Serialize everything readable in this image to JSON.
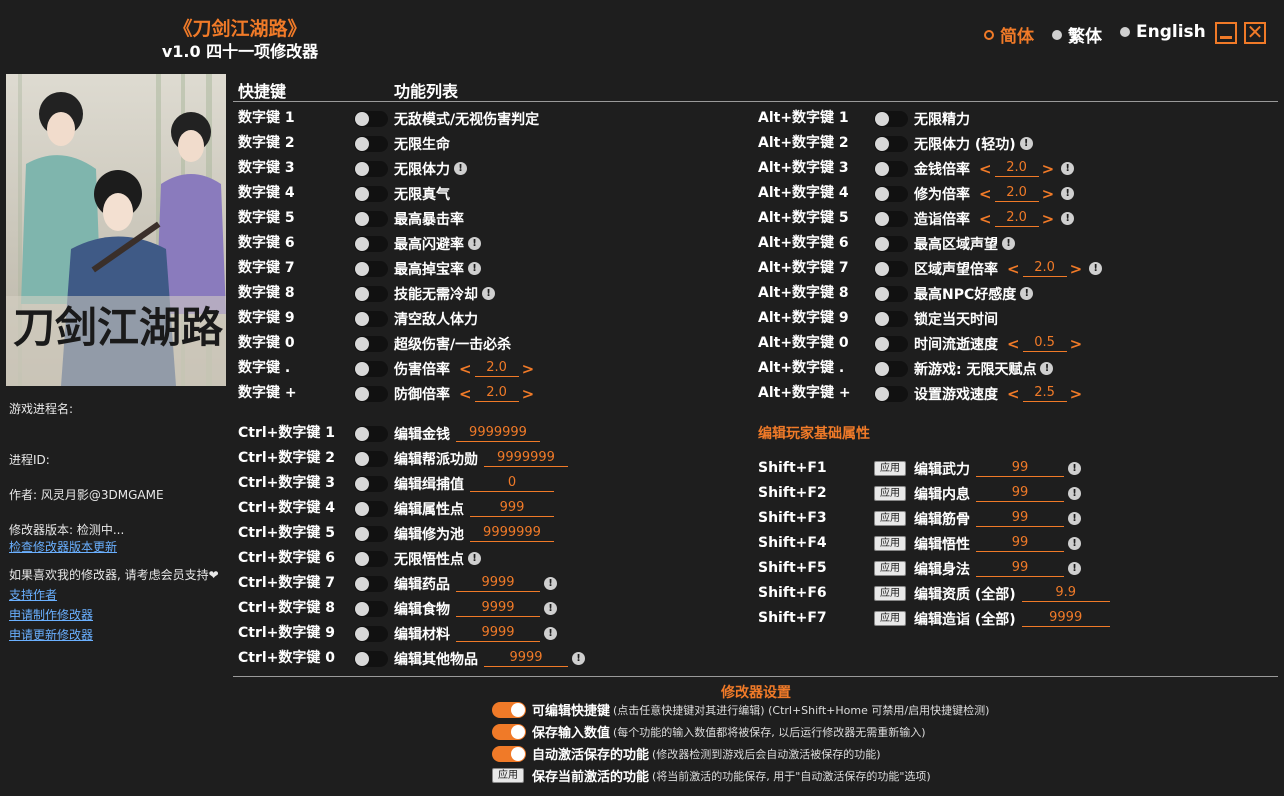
{
  "app": {
    "title": "《刀剑江湖路》",
    "subtitle": "v1.0 四十一项修改器"
  },
  "languages": [
    {
      "label": "简体",
      "selected": true
    },
    {
      "label": "繁体",
      "selected": false
    },
    {
      "label": "English",
      "selected": false
    }
  ],
  "window": {
    "close_glyph": "✕"
  },
  "cover": {
    "logo_text": "刀剑江湖路"
  },
  "sidebar": {
    "process_label": "游戏进程名:",
    "pid_label": "进程ID:",
    "author": "作者: 风灵月影@3DMGAME",
    "version": "修改器版本: 检测中...",
    "check_update": "检查修改器版本更新",
    "support_text": "如果喜欢我的修改器, 请考虑会员支持",
    "heart_glyph": "❤",
    "links": [
      "支持作者",
      "申请制作修改器",
      "申请更新修改器"
    ]
  },
  "headers": {
    "hotkeys": "快捷键",
    "features": "功能列表"
  },
  "left_features": [
    {
      "key": "数字键 1",
      "label": "无敌模式/无视伤害判定",
      "warn": false
    },
    {
      "key": "数字键 2",
      "label": "无限生命",
      "warn": false
    },
    {
      "key": "数字键 3",
      "label": "无限体力",
      "warn": true
    },
    {
      "key": "数字键 4",
      "label": "无限真气",
      "warn": false
    },
    {
      "key": "数字键 5",
      "label": "最高暴击率",
      "warn": false
    },
    {
      "key": "数字键 6",
      "label": "最高闪避率",
      "warn": true
    },
    {
      "key": "数字键 7",
      "label": "最高掉宝率",
      "warn": true
    },
    {
      "key": "数字键 8",
      "label": "技能无需冷却",
      "warn": true
    },
    {
      "key": "数字键 9",
      "label": "清空敌人体力",
      "warn": false
    },
    {
      "key": "数字键 0",
      "label": "超级伤害/一击必杀",
      "warn": false
    },
    {
      "key": "数字键 .",
      "label": "伤害倍率",
      "warn": false,
      "value": "2.0"
    },
    {
      "key": "数字键 +",
      "label": "防御倍率",
      "warn": false,
      "value": "2.0"
    }
  ],
  "ctrl_features": [
    {
      "key": "Ctrl+数字键 1",
      "label": "编辑金钱",
      "value": "9999999",
      "warn": false
    },
    {
      "key": "Ctrl+数字键 2",
      "label": "编辑帮派功勋",
      "value": "9999999",
      "warn": false
    },
    {
      "key": "Ctrl+数字键 3",
      "label": "编辑缉捕值",
      "value": "0",
      "warn": false
    },
    {
      "key": "Ctrl+数字键 4",
      "label": "编辑属性点",
      "value": "999",
      "warn": false
    },
    {
      "key": "Ctrl+数字键 5",
      "label": "编辑修为池",
      "value": "9999999",
      "warn": false
    },
    {
      "key": "Ctrl+数字键 6",
      "label": "无限悟性点",
      "warn": true
    },
    {
      "key": "Ctrl+数字键 7",
      "label": "编辑药品",
      "value": "9999",
      "warn": true
    },
    {
      "key": "Ctrl+数字键 8",
      "label": "编辑食物",
      "value": "9999",
      "warn": true
    },
    {
      "key": "Ctrl+数字键 9",
      "label": "编辑材料",
      "value": "9999",
      "warn": true
    },
    {
      "key": "Ctrl+数字键 0",
      "label": "编辑其他物品",
      "value": "9999",
      "warn": true
    }
  ],
  "alt_features": [
    {
      "key": "Alt+数字键 1",
      "label": "无限精力",
      "warn": false
    },
    {
      "key": "Alt+数字键 2",
      "label": "无限体力 (轻功)",
      "warn": true
    },
    {
      "key": "Alt+数字键 3",
      "label": "金钱倍率",
      "value": "2.0",
      "warn": true
    },
    {
      "key": "Alt+数字键 4",
      "label": "修为倍率",
      "value": "2.0",
      "warn": true
    },
    {
      "key": "Alt+数字键 5",
      "label": "造诣倍率",
      "value": "2.0",
      "warn": true
    },
    {
      "key": "Alt+数字键 6",
      "label": "最高区域声望",
      "warn": true
    },
    {
      "key": "Alt+数字键 7",
      "label": "区域声望倍率",
      "value": "2.0",
      "warn": true
    },
    {
      "key": "Alt+数字键 8",
      "label": "最高NPC好感度",
      "warn": true
    },
    {
      "key": "Alt+数字键 9",
      "label": "锁定当天时间",
      "warn": false
    },
    {
      "key": "Alt+数字键 0",
      "label": "时间流逝速度",
      "value": "0.5",
      "warn": false
    },
    {
      "key": "Alt+数字键 .",
      "label": "新游戏: 无限天赋点",
      "warn": true
    },
    {
      "key": "Alt+数字键 +",
      "label": "设置游戏速度",
      "value": "2.5",
      "warn": false
    }
  ],
  "player_section": {
    "title": "编辑玩家基础属性",
    "apply_label": "应用",
    "rows": [
      {
        "key": "Shift+F1",
        "label": "编辑武力",
        "value": "99",
        "warn": true
      },
      {
        "key": "Shift+F2",
        "label": "编辑内息",
        "value": "99",
        "warn": true
      },
      {
        "key": "Shift+F3",
        "label": "编辑筋骨",
        "value": "99",
        "warn": true
      },
      {
        "key": "Shift+F4",
        "label": "编辑悟性",
        "value": "99",
        "warn": true
      },
      {
        "key": "Shift+F5",
        "label": "编辑身法",
        "value": "99",
        "warn": true
      },
      {
        "key": "Shift+F6",
        "label": "编辑资质 (全部)",
        "value": "9.9",
        "warn": false
      },
      {
        "key": "Shift+F7",
        "label": "编辑造诣 (全部)",
        "value": "9999",
        "warn": false
      }
    ]
  },
  "settings": {
    "title": "修改器设置",
    "items": [
      {
        "type": "toggle",
        "on": true,
        "label": "可编辑快捷键",
        "note": "(点击任意快捷键对其进行编辑) (Ctrl+Shift+Home 可禁用/启用快捷键检测)"
      },
      {
        "type": "toggle",
        "on": true,
        "label": "保存输入数值",
        "note": "(每个功能的输入数值都将被保存, 以后运行修改器无需重新输入)"
      },
      {
        "type": "toggle",
        "on": true,
        "label": "自动激活保存的功能",
        "note": "(修改器检测到游戏后会自动激活被保存的功能)"
      },
      {
        "type": "apply",
        "label": "保存当前激活的功能",
        "note": "(将当前激活的功能保存, 用于\"自动激活保存的功能\"选项)",
        "button": "应用"
      }
    ]
  },
  "symbols": {
    "warn": "!",
    "arrow_left": "<",
    "arrow_right": ">"
  },
  "colors": {
    "accent": "#f07a28",
    "background": "#1e1e1e",
    "link": "#6ab0ff"
  }
}
